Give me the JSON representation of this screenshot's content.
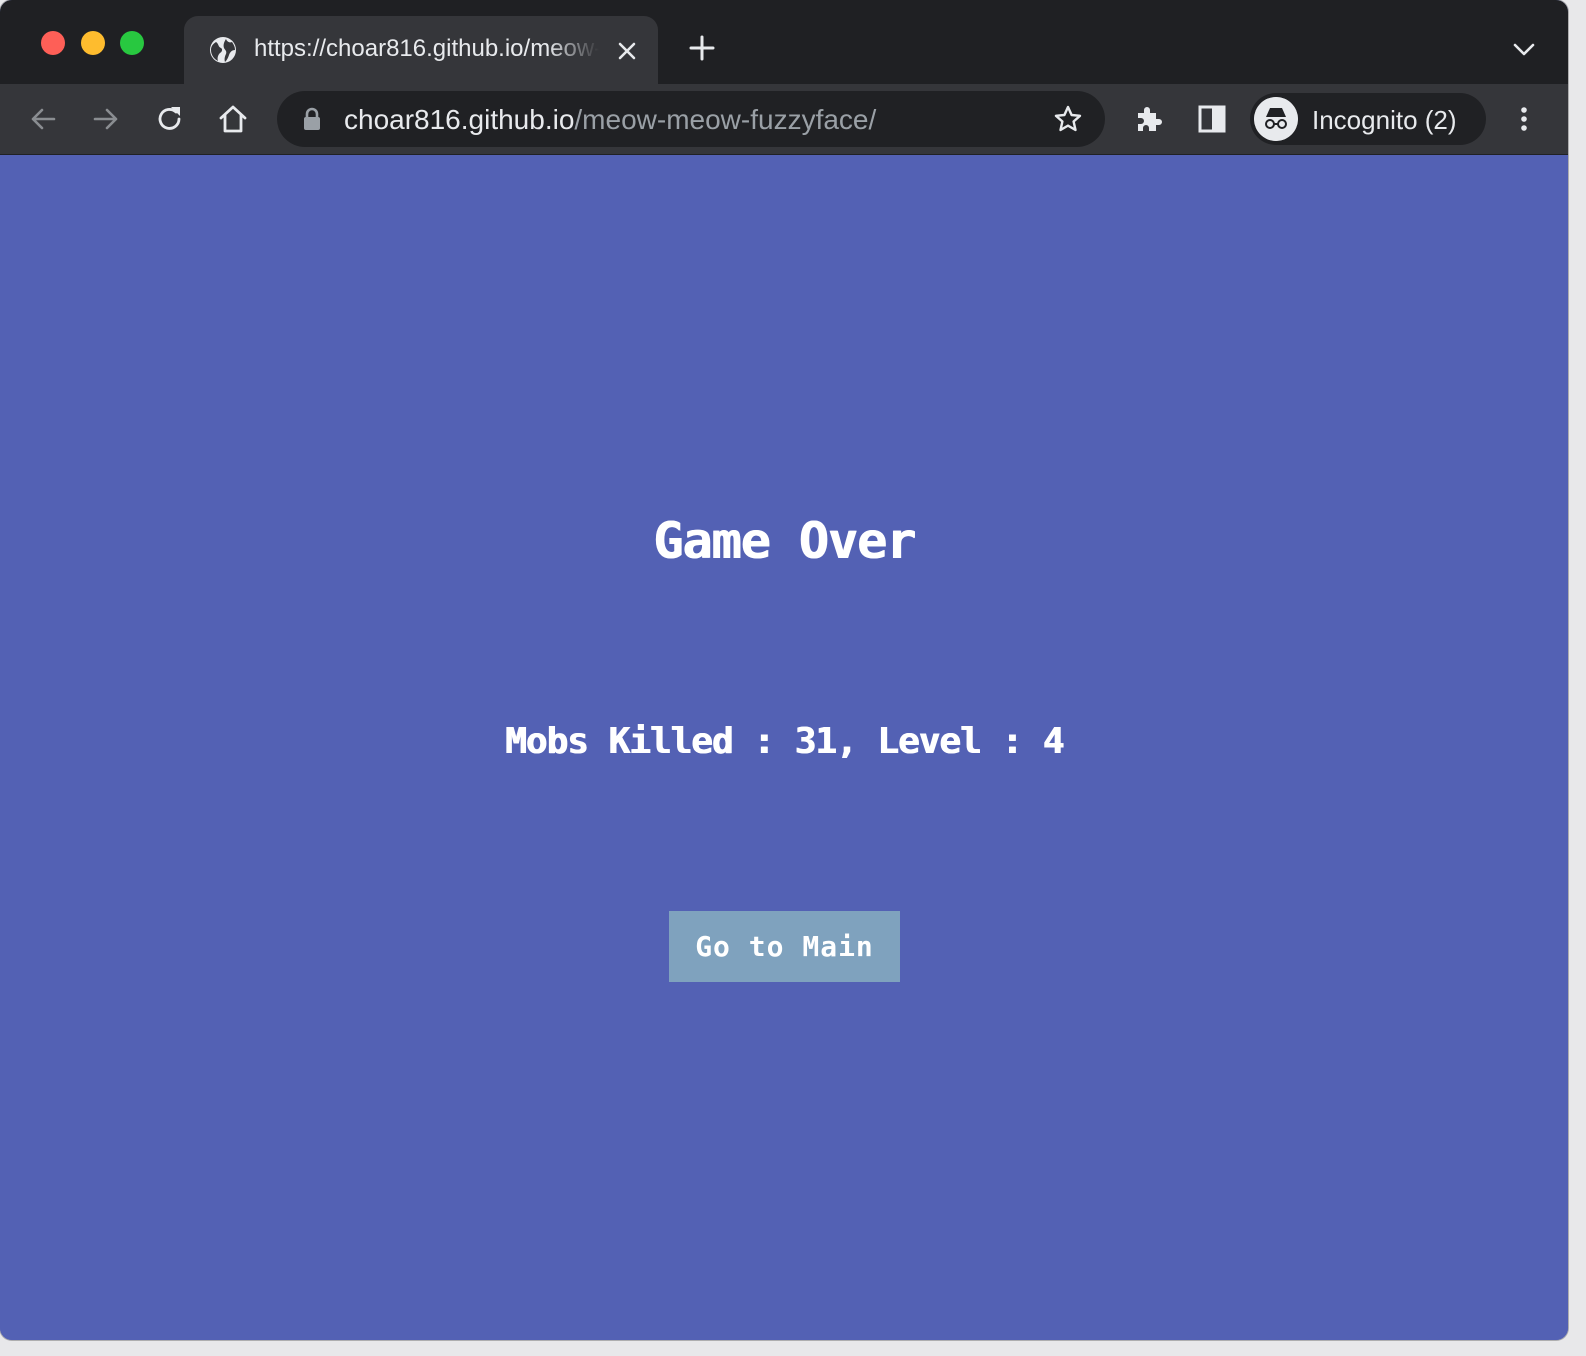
{
  "browser": {
    "tab_title": "https://choar816.github.io/meow-meow-fuzzyface/",
    "url_host": "choar816.github.io",
    "url_path": "/meow-meow-fuzzyface/",
    "profile_label": "Incognito (2)",
    "icons": [
      "back-icon",
      "forward-icon",
      "reload-icon",
      "home-icon",
      "lock-icon",
      "star-icon",
      "extensions-icon",
      "side-panel-icon",
      "incognito-icon",
      "menu-icon",
      "globe-icon",
      "close-icon",
      "plus-icon",
      "chevron-down-icon"
    ]
  },
  "game": {
    "title": "Game Over",
    "mobs_label": "Mobs Killed",
    "separator": " : ",
    "mobs_killed": "31",
    "level_label": "Level",
    "level": "4",
    "go_main_label": "Go to Main"
  },
  "colors": {
    "background": "#5361b4",
    "button": "#7fa2be",
    "text": "#ffffff"
  }
}
